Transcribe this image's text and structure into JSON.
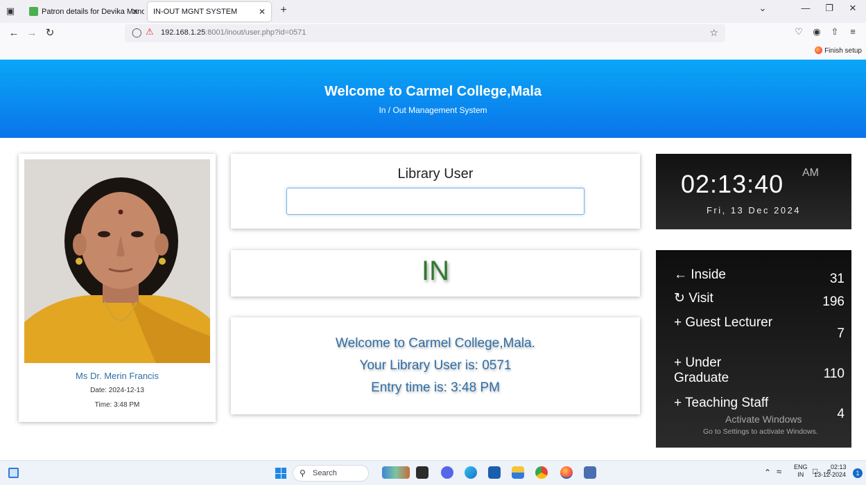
{
  "browser": {
    "tabs": [
      {
        "title": "Patron details for Devika Manoj",
        "active": false
      },
      {
        "title": "IN-OUT MGNT SYSTEM",
        "active": true
      }
    ],
    "url_host": "192.168.1.25",
    "url_path": ":8001/inout/user.php?id=0571",
    "finish_setup": "Finish setup"
  },
  "header": {
    "title": "Welcome to Carmel College,Mala",
    "subtitle": "In / Out Management System"
  },
  "profile": {
    "name": "Ms Dr. Merin Francis",
    "date": "Date: 2024-12-13",
    "time": "Time: 3:48 PM"
  },
  "library": {
    "title": "Library User",
    "input_value": ""
  },
  "status": {
    "text": "IN",
    "color": "#2f7a2f"
  },
  "message": {
    "line1": "Welcome to Carmel College,Mala.",
    "line2": "Your Library User is: 0571",
    "line3": "Entry time is: 3:48 PM"
  },
  "clock": {
    "time": "02:13:40",
    "ampm": "AM",
    "date": "Fri, 13 Dec 2024"
  },
  "stats": [
    {
      "icon": "←",
      "icon_name": "arrow-left-icon",
      "label": "Inside",
      "value": "31"
    },
    {
      "icon": "↻",
      "icon_name": "refresh-icon",
      "label": "Visit",
      "value": "196"
    },
    {
      "icon": "+",
      "icon_name": "plus-icon",
      "label": "Guest Lecturer",
      "value": "7"
    },
    {
      "icon": "+",
      "icon_name": "plus-icon",
      "label": "Under Graduate",
      "value": "110"
    },
    {
      "icon": "+",
      "icon_name": "plus-icon",
      "label": "Teaching Staff",
      "value": "4"
    }
  ],
  "watermark": {
    "line1": "Activate Windows",
    "line2": "Go to Settings to activate Windows."
  },
  "taskbar": {
    "search_placeholder": "Search",
    "lang_top": "ENG",
    "lang_bottom": "IN",
    "time": "02:13",
    "date": "13-12-2024",
    "notification_count": "1"
  }
}
